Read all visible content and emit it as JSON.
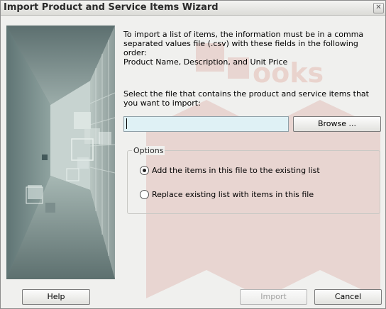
{
  "window": {
    "title": "Import Product and Service Items Wizard",
    "close_glyph": "✕"
  },
  "intro": {
    "lines": [
      "To import a list of items, the information must be in a comma",
      "separated values file (.csv) with these fields in the following",
      "order:",
      "Product Name, Description, and Unit Price"
    ]
  },
  "select_file": {
    "text": "Select the file that contains the product and service items that you want to import:",
    "input_value": "",
    "browse_label": "Browse ..."
  },
  "options": {
    "legend": "Options",
    "radios": [
      {
        "label": "Add the items in this file to the existing list",
        "selected": true
      },
      {
        "label": "Replace existing list with items in this file",
        "selected": false
      }
    ]
  },
  "footer": {
    "help_label": "Help",
    "import_label": "Import",
    "cancel_label": "Cancel"
  },
  "watermark": {
    "text": "ooks"
  },
  "colors": {
    "window_bg": "#f0f0ee",
    "input_bg": "#dff1f5",
    "watermark": "#d98a7a"
  }
}
